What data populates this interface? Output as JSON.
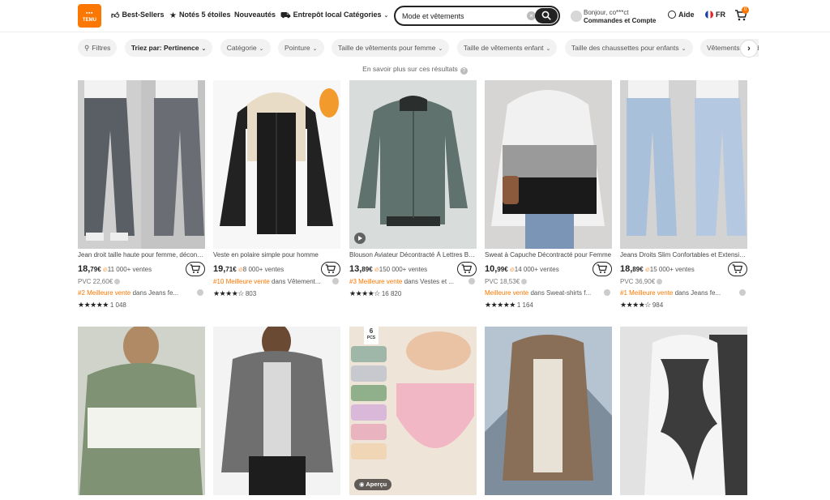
{
  "header": {
    "logo_top": "⬛⬛⬛",
    "logo_text": "TEMU",
    "nav": [
      {
        "label": "Best-Sellers",
        "icon": "thumbs-up-icon"
      },
      {
        "label": "Notés 5 étoiles",
        "icon": "star-badge-icon"
      },
      {
        "label": "Nouveautés",
        "icon": ""
      },
      {
        "label": "Entrepôt local",
        "icon": "truck-icon"
      },
      {
        "label": "Catégories",
        "icon": "chevron-down-icon"
      }
    ],
    "search": {
      "value": "Mode et vêtements"
    },
    "account": {
      "greeting": "Bonjour, co***ct",
      "label": "Commandes et Compte"
    },
    "help": "Aide",
    "lang": "FR",
    "cart_count": "0"
  },
  "filters": [
    "Filtres",
    "Triez par: Pertinence",
    "Catégorie",
    "Pointure",
    "Taille de vêtements pour femme",
    "Taille de vêtements enfant",
    "Taille des chaussettes pour enfants",
    "Vêtements grande taille fe"
  ],
  "learn_more": "En savoir plus sur ces résultats",
  "products": [
    {
      "title": "Jean droit taille haute pour femme, décontracté",
      "price_int": "18,",
      "price_dec": "79€",
      "sales": "11 000+ ventes",
      "pvc": "PVC 22,60€",
      "rank_hl": "#2 Meilleure vente",
      "rank_rest": " dans Jeans fe...",
      "stars": "★★★★★",
      "reviews": "1 048"
    },
    {
      "title": "Veste en polaire simple pour homme",
      "price_int": "19,",
      "price_dec": "71€",
      "sales": "8 000+ ventes",
      "pvc": "",
      "rank_hl": "#10 Meilleure vente",
      "rank_rest": " dans Vêtement...",
      "stars": "★★★★☆",
      "reviews": "803"
    },
    {
      "title": "Blouson Aviateur Décontracté À Lettres Brodées",
      "price_int": "13,",
      "price_dec": "89€",
      "sales": "150 000+ ventes",
      "pvc": "",
      "rank_hl": "#3 Meilleure vente",
      "rank_rest": " dans Vestes et ...",
      "stars": "★★★★☆",
      "reviews": "16 820"
    },
    {
      "title": "Sweat à Capuche Décontracté pour Femme",
      "price_int": "10,",
      "price_dec": "99€",
      "sales": "14 000+ ventes",
      "pvc": "PVC 18,53€",
      "rank_hl": "Meilleure vente",
      "rank_rest": " dans Sweat-shirts f...",
      "stars": "★★★★★",
      "reviews": "1 164"
    },
    {
      "title": "Jeans Droits Slim Confortables et Extensibles",
      "price_int": "18,",
      "price_dec": "89€",
      "sales": "15 000+ ventes",
      "pvc": "PVC 36,90€",
      "rank_hl": "#1 Meilleure vente",
      "rank_rest": " dans Jeans fe...",
      "stars": "★★★★☆",
      "reviews": "984"
    }
  ],
  "second_row": {
    "pcs_count": "6",
    "pcs_label": "PCS",
    "apercu": "Aperçu"
  },
  "colors": {
    "accent": "#fb7701",
    "text": "#222222",
    "chip_bg": "#f2f2f2"
  }
}
